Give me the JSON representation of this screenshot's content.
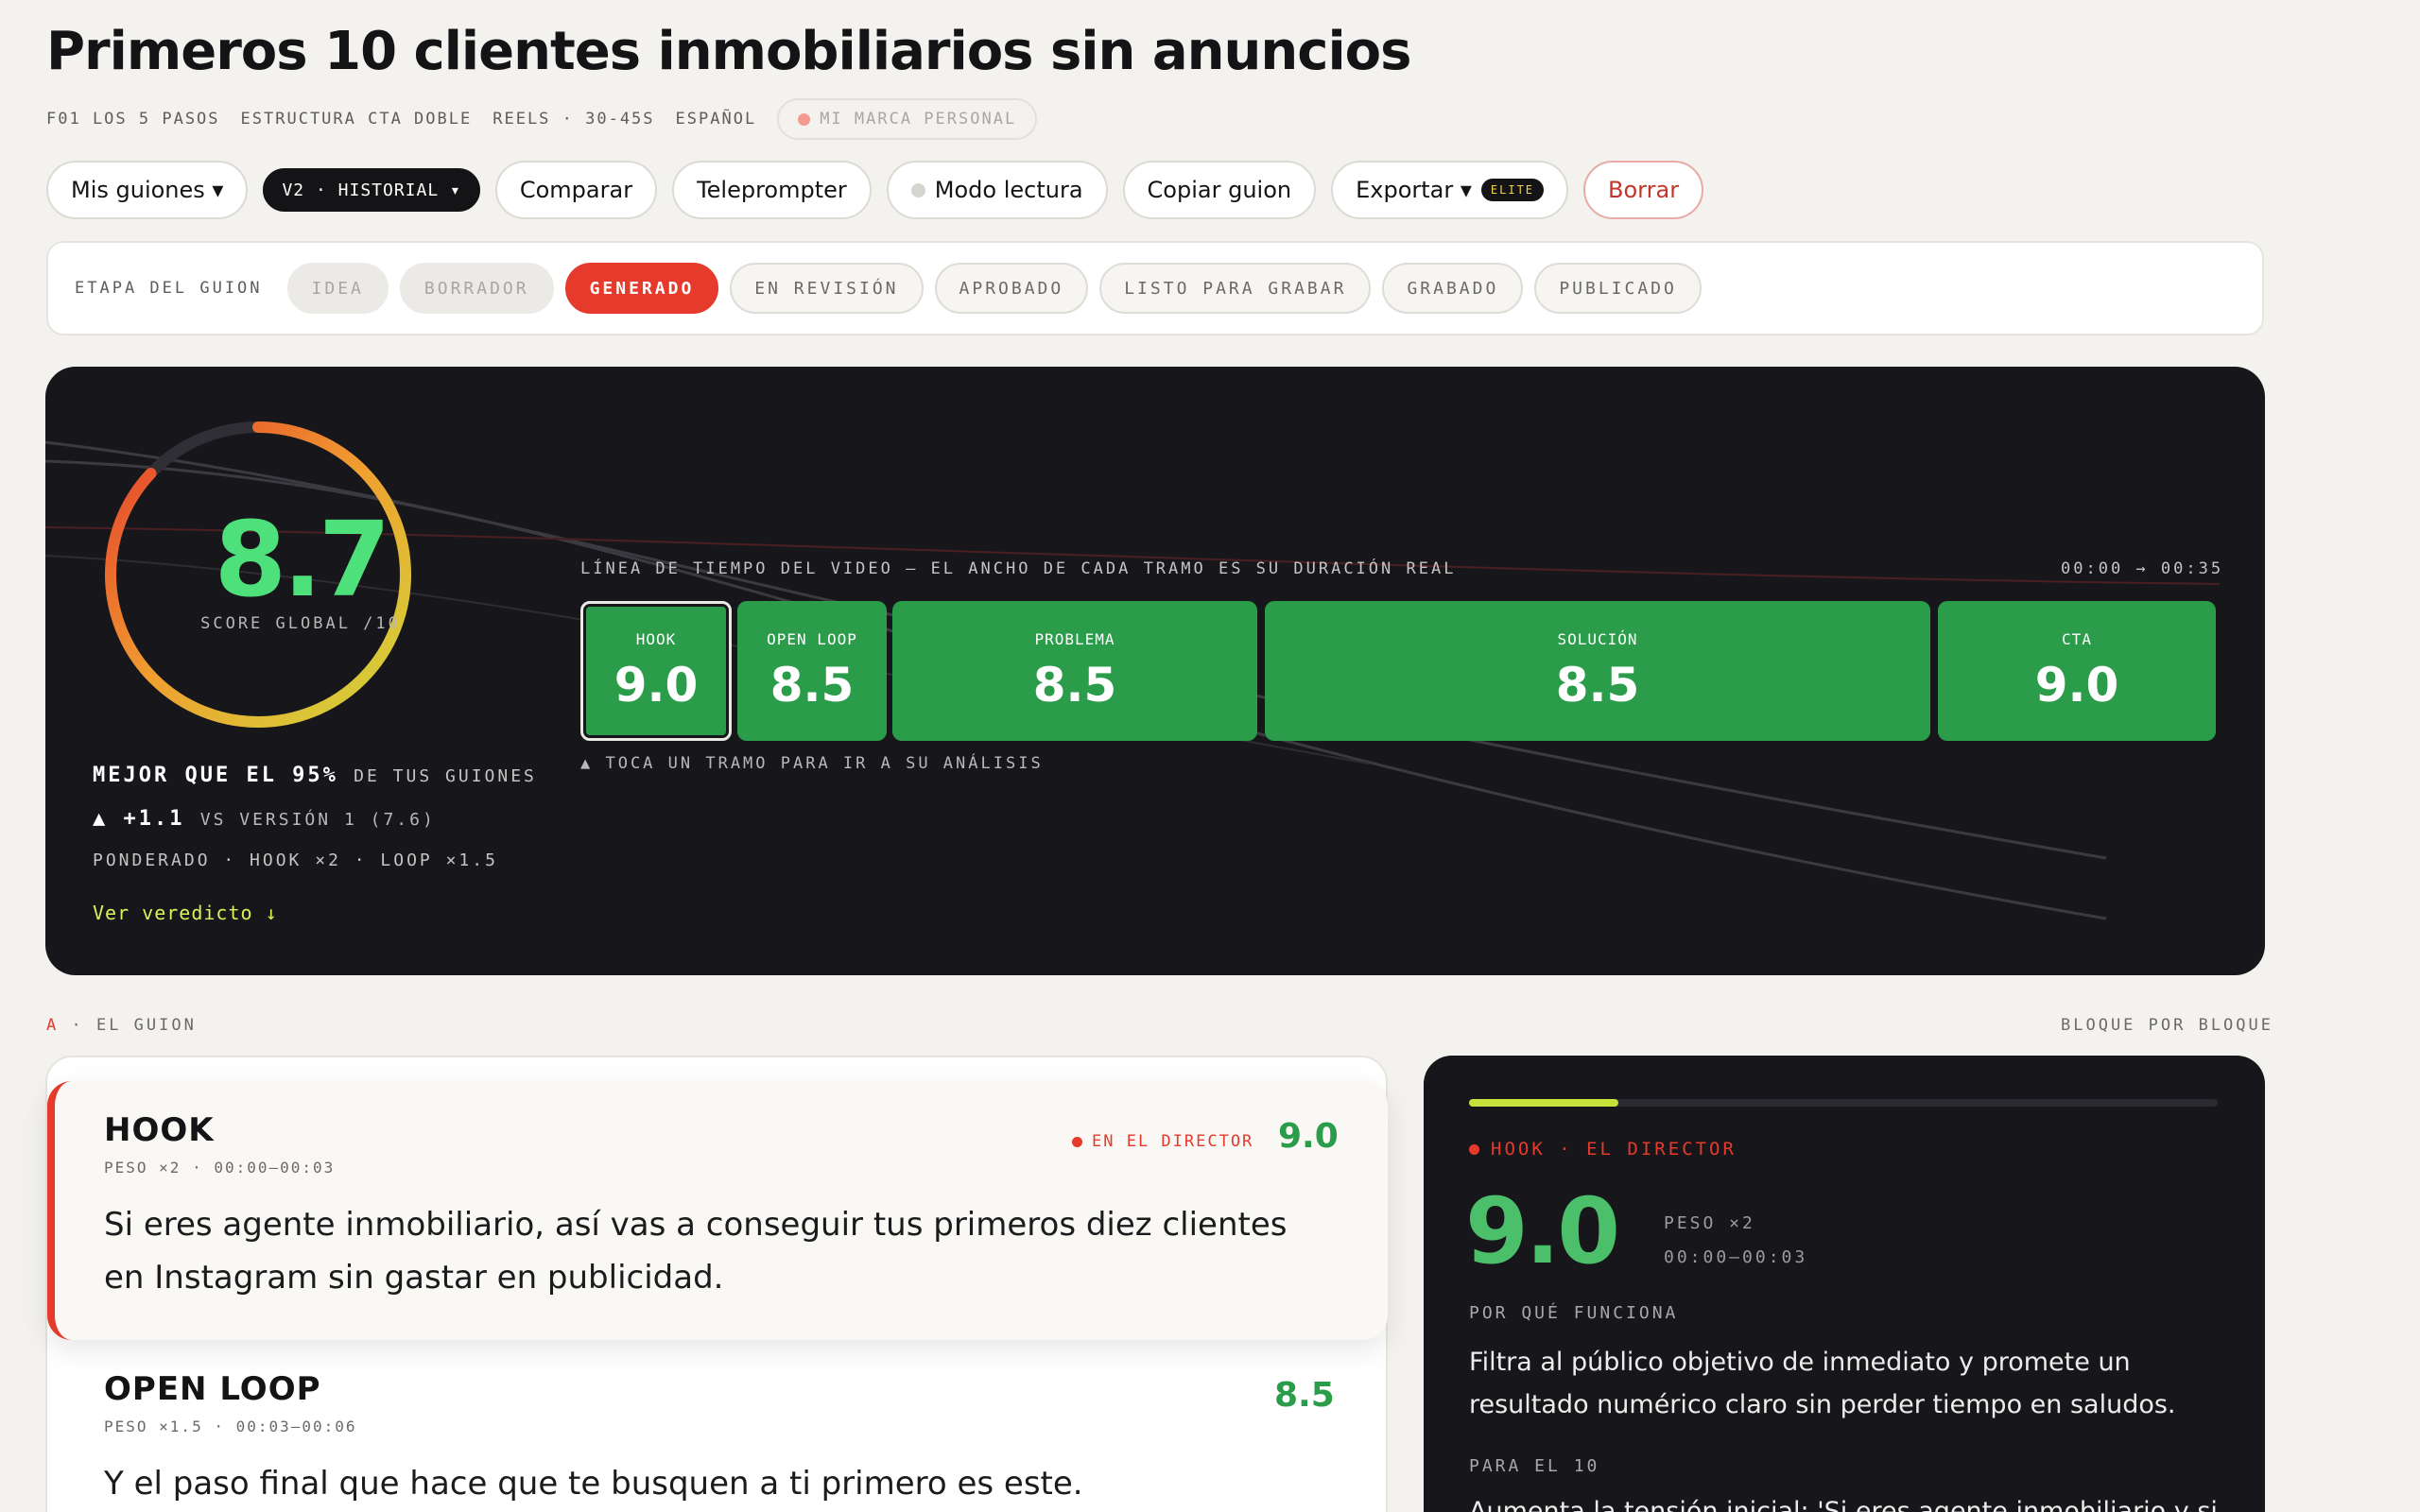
{
  "header": {
    "title": "Primeros 10 clientes inmobiliarios sin anuncios",
    "meta": [
      "F01 LOS 5 PASOS",
      "ESTRUCTURA CTA DOBLE",
      "REELS · 30-45S",
      "ESPAÑOL"
    ],
    "brand_pill": "MI MARCA PERSONAL"
  },
  "toolbar": {
    "my_scripts": "Mis guiones ▾",
    "version": "V2 · HISTORIAL ▾",
    "compare": "Comparar",
    "teleprompter": "Teleprompter",
    "reading_mode": "Modo lectura",
    "copy": "Copiar guion",
    "export": "Exportar ▾",
    "elite_badge": "ELITE",
    "delete": "Borrar"
  },
  "stages": {
    "label": "ETAPA DEL GUION",
    "items": [
      "IDEA",
      "BORRADOR",
      "GENERADO",
      "EN REVISIÓN",
      "APROBADO",
      "LISTO PARA GRABAR",
      "GRABADO",
      "PUBLICADO"
    ],
    "active": "GENERADO"
  },
  "score": {
    "value": "8.7",
    "label": "SCORE GLOBAL /10",
    "better_strong": "MEJOR QUE EL 95%",
    "better_rest": "DE TUS GUIONES",
    "delta_strong": "▲ +1.1",
    "delta_rest": "VS VERSIÓN 1 (7.6)",
    "weights": "PONDERADO · HOOK ×2 · LOOP ×1.5",
    "verdict_link": "Ver veredicto ↓"
  },
  "timeline": {
    "label": "LÍNEA DE TIEMPO DEL VIDEO — EL ANCHO DE CADA TRAMO ES SU DURACIÓN REAL",
    "range": "00:00 → 00:35",
    "hint": "▲ TOCA UN TRAMO PARA IR A SU ANÁLISIS",
    "segments": [
      {
        "name": "HOOK",
        "score": "9.0"
      },
      {
        "name": "OPEN LOOP",
        "score": "8.5"
      },
      {
        "name": "PROBLEMA",
        "score": "8.5"
      },
      {
        "name": "SOLUCIÓN",
        "score": "8.5"
      },
      {
        "name": "CTA",
        "score": "9.0"
      }
    ]
  },
  "section": {
    "letter": "A",
    "title": "· EL GUION",
    "right": "BLOQUE POR BLOQUE"
  },
  "script_blocks": [
    {
      "name": "HOOK",
      "meta": "PESO ×2 · 00:00–00:03",
      "director_tag": "EN EL DIRECTOR",
      "score": "9.0",
      "text": "Si eres agente inmobiliario, así vas a conseguir tus primeros diez clientes en Instagram sin gastar en publicidad."
    },
    {
      "name": "OPEN LOOP",
      "meta": "PESO ×1.5 · 00:03–00:06",
      "score": "8.5",
      "text": "Y el paso final que hace que te busquen a ti primero es este."
    }
  ],
  "director": {
    "progress": 0.2,
    "tag": "HOOK · EL DIRECTOR",
    "score": "9.0",
    "weight": "PESO ×2",
    "time": "00:00–00:03",
    "why_heading": "POR QUÉ FUNCIONA",
    "why_text": "Filtra al público objetivo de inmediato y promete un resultado numérico claro sin perder tiempo en saludos.",
    "to10_heading": "PARA EL 10",
    "to10_text": "Aumenta la tensión inicial: 'Si eres agente inmobiliario y sigues sin"
  }
}
